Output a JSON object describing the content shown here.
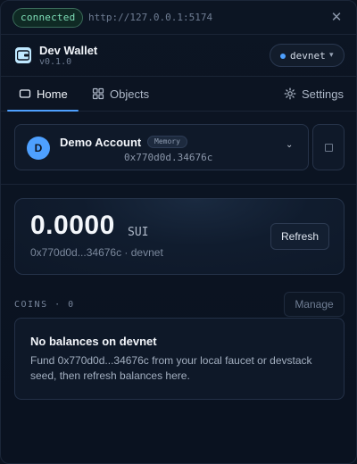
{
  "topbar": {
    "status": "connected",
    "url": "http://127.0.0.1:5174",
    "close": "✕"
  },
  "app": {
    "title": "Dev Wallet",
    "version": "v0.1.0"
  },
  "network": {
    "label": "devnet",
    "dot_color": "#4ea0ff"
  },
  "tabs": [
    {
      "label": "Home",
      "icon": "wallet-icon",
      "active": true
    },
    {
      "label": "Objects",
      "icon": "grid-icon",
      "active": false
    },
    {
      "label": "Settings",
      "icon": "gear-icon",
      "active": false
    }
  ],
  "account": {
    "initial": "D",
    "name": "Demo Account",
    "badge": "Memory",
    "address": "0x770d0d.34676c"
  },
  "balance": {
    "amount": "0.0000",
    "unit": "SUI",
    "subtitle": "0x770d0d...34676c · devnet",
    "refresh_label": "Refresh"
  },
  "coins": {
    "section_label": "COINS · 0",
    "manage_label": "Manage",
    "empty_title": "No balances on devnet",
    "empty_body": "Fund 0x770d0d...34676c from your local faucet or devstack seed, then refresh balances here."
  },
  "colors": {
    "accent": "#4ea0ff",
    "connected": "#7fe0b8",
    "background": "#0b1320"
  }
}
